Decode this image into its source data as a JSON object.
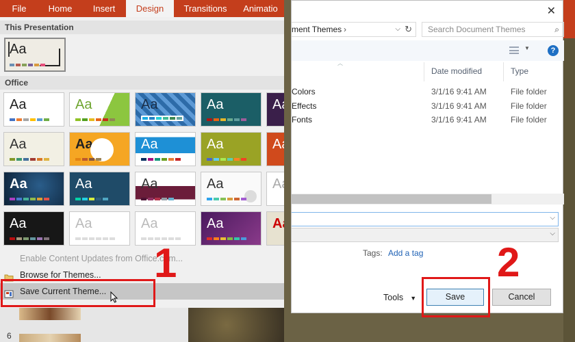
{
  "ribbon": {
    "tabs": [
      "File",
      "Home",
      "Insert",
      "Design",
      "Transitions",
      "Animatio"
    ]
  },
  "gallery": {
    "this_presentation_heading": "This Presentation",
    "office_heading": "Office",
    "thumb_text": "Aa"
  },
  "menu": {
    "enable_updates": "Enable Content Updates from Office.com...",
    "browse": "Browse for Themes...",
    "save_current": "Save Current Theme..."
  },
  "slides_panel": {
    "slide_number": "6"
  },
  "step_labels": {
    "first": "1",
    "second": "2"
  },
  "dialog": {
    "address": "ment Themes",
    "search_placeholder": "Search Document Themes",
    "columns": {
      "name": "",
      "date": "Date modified",
      "type": "Type"
    },
    "rows": [
      {
        "name": "Colors",
        "date": "3/1/16 9:41 AM",
        "type": "File folder"
      },
      {
        "name": "Effects",
        "date": "3/1/16 9:41 AM",
        "type": "File folder"
      },
      {
        "name": "Fonts",
        "date": "3/1/16 9:41 AM",
        "type": "File folder"
      }
    ],
    "tags_label": "Tags:",
    "tags_link": "Add a tag",
    "tools": "Tools",
    "save": "Save",
    "cancel": "Cancel",
    "help": "?",
    "close": "✕"
  },
  "colors": {
    "accent": "#c43e1c",
    "highlight": "#e01818",
    "link": "#1f62b5"
  }
}
